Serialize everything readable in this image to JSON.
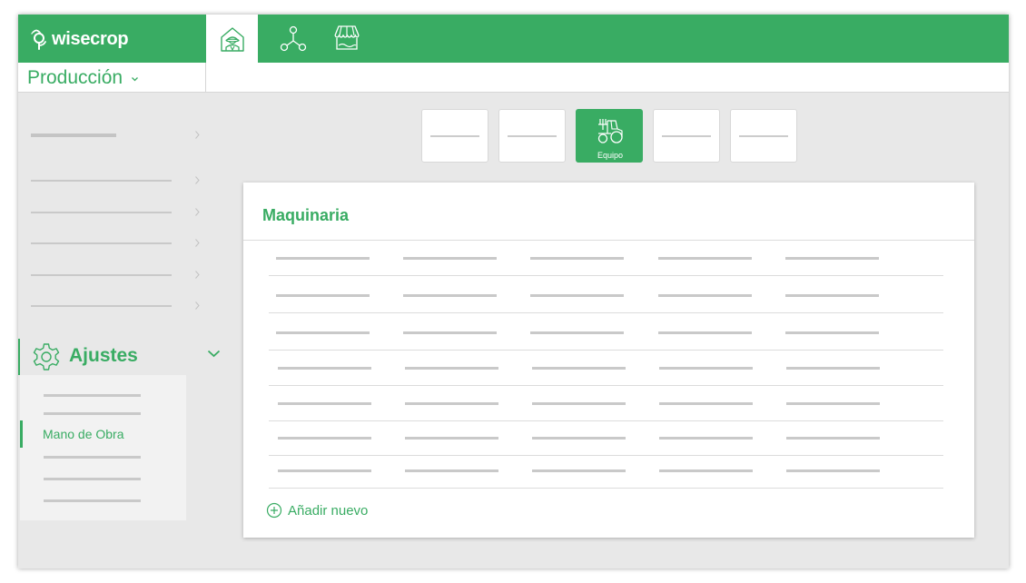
{
  "brand": {
    "name": "wisecrop",
    "color": "#39ac63"
  },
  "topnav": {
    "tabs": [
      {
        "icon": "farmer-icon",
        "active": true
      },
      {
        "icon": "network-icon",
        "active": false
      },
      {
        "icon": "market-stall-icon",
        "active": false
      }
    ]
  },
  "module": {
    "label": "Producción",
    "icon": "chevron-down-icon"
  },
  "sidebar": {
    "section": {
      "label": "Ajustes",
      "icon": "gear-icon",
      "expanded": true
    },
    "active_item": {
      "label": "Mano de Obra"
    }
  },
  "categories": {
    "items": [
      {
        "label": "",
        "active": false
      },
      {
        "label": "",
        "active": false
      },
      {
        "label": "Equipo",
        "icon": "tractor-icon",
        "active": true
      },
      {
        "label": "",
        "active": false
      },
      {
        "label": "",
        "active": false
      }
    ]
  },
  "main": {
    "title": "Maquinaria",
    "add_label": "Añadir nuevo",
    "add_icon": "plus-circle-icon"
  }
}
